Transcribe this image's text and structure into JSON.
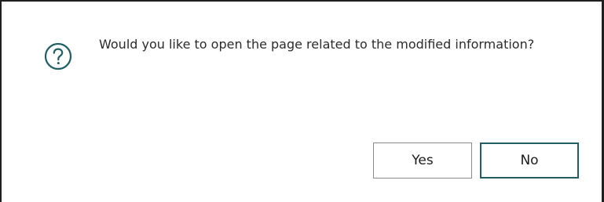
{
  "dialog": {
    "message": "Would you like to open the page related to the modified information?",
    "icon": "question-icon",
    "buttons": {
      "yes_label": "Yes",
      "no_label": "No"
    }
  },
  "colors": {
    "accent": "#1f5f63",
    "border": "#1f1f1f",
    "text": "#2b2b2b"
  }
}
